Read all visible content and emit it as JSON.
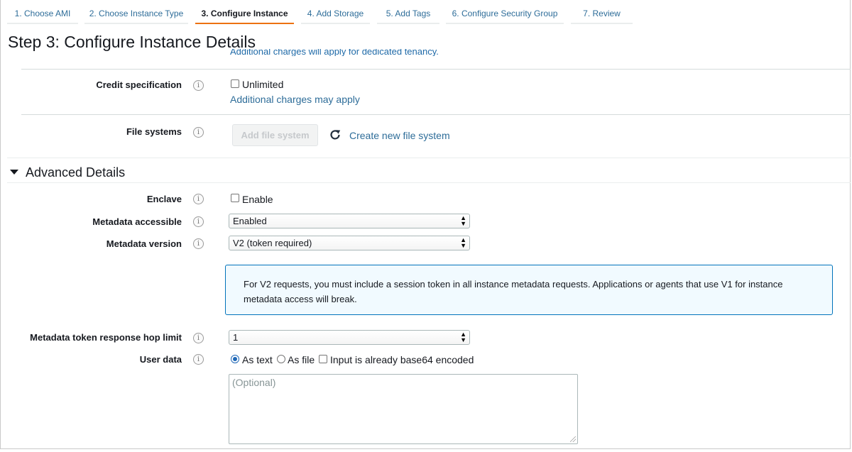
{
  "wizard_tabs": [
    {
      "label": "1. Choose AMI"
    },
    {
      "label": "2. Choose Instance Type"
    },
    {
      "label": "3. Configure Instance"
    },
    {
      "label": "4. Add Storage"
    },
    {
      "label": "5. Add Tags"
    },
    {
      "label": "6. Configure Security Group"
    },
    {
      "label": "7. Review"
    }
  ],
  "active_tab_index": 2,
  "page_title": "Step 3: Configure Instance Details",
  "tenancy_note": "Additional charges will apply for dedicated tenancy.",
  "info_glyph": "i",
  "credit": {
    "label": "Credit specification",
    "checkbox_label": "Unlimited",
    "checked": false,
    "link": "Additional charges may apply"
  },
  "file_systems": {
    "label": "File systems",
    "add_button": "Add file system",
    "refresh_icon": "refresh-icon",
    "create_link": "Create new file system"
  },
  "advanced": {
    "title": "Advanced Details",
    "expanded": true
  },
  "enclave": {
    "label": "Enclave",
    "checkbox_label": "Enable",
    "checked": false
  },
  "metadata_accessible": {
    "label": "Metadata accessible",
    "value": "Enabled"
  },
  "metadata_version": {
    "label": "Metadata version",
    "value": "V2 (token required)"
  },
  "v2_note": "For V2 requests, you must include a session token in all instance metadata requests. Applications or agents that use V1 for instance metadata access will break.",
  "hop_limit": {
    "label": "Metadata token response hop limit",
    "value": "1"
  },
  "user_data": {
    "label": "User data",
    "option_text": "As text",
    "option_file": "As file",
    "base64_label": "Input is already base64 encoded",
    "selected": "As text",
    "placeholder": "(Optional)"
  },
  "colors": {
    "accent_tab": "#ec7211",
    "link": "#2e6d99",
    "info_border": "#0073bb",
    "info_bg": "#f1faff"
  }
}
